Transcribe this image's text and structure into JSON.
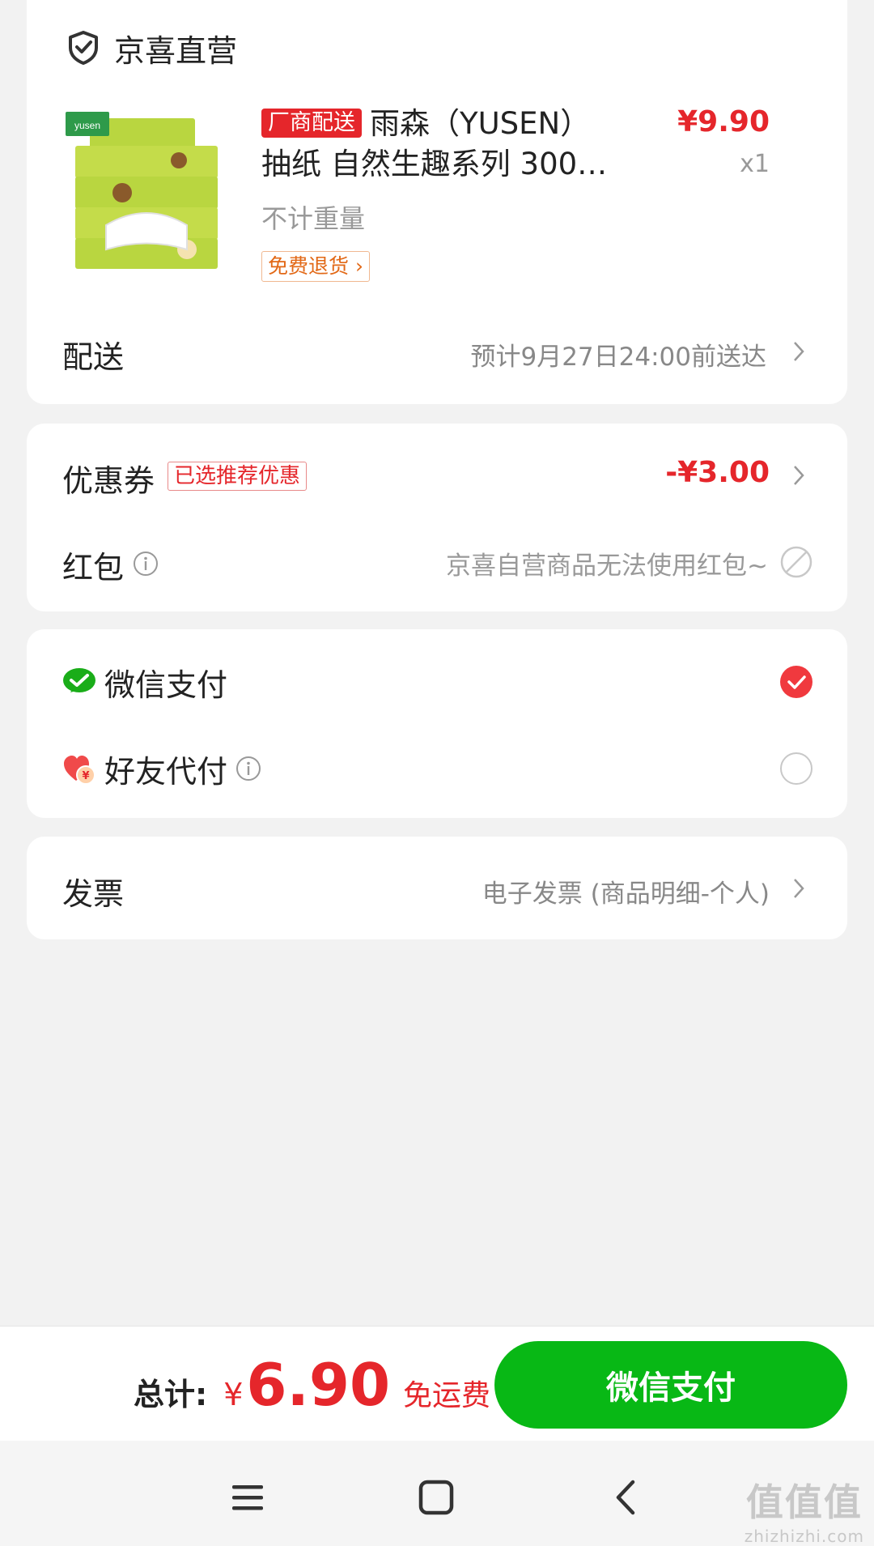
{
  "shop": {
    "name": "京喜直营",
    "icon": "shield-check-icon"
  },
  "product": {
    "vendor_badge": "厂商配送",
    "title": "雨森（YUSEN）抽纸 自然生趣系列 300…",
    "price": "¥9.90",
    "quantity": "x1",
    "spec": "不计重量",
    "return_tag": "免费退货",
    "image_brand": "yusen"
  },
  "delivery": {
    "label": "配送",
    "value": "预计9月27日24:00前送达"
  },
  "coupon": {
    "label": "优惠券",
    "tag": "已选推荐优惠",
    "value": "-¥3.00"
  },
  "red_packet": {
    "label": "红包",
    "value": "京喜自营商品无法使用红包~"
  },
  "payment": {
    "options": [
      {
        "label": "微信支付",
        "icon": "wechat-pay-icon",
        "selected": true
      },
      {
        "label": "好友代付",
        "icon": "friend-pay-heart-icon",
        "selected": false
      }
    ]
  },
  "invoice": {
    "label": "发票",
    "value": "电子发票 (商品明细-个人)"
  },
  "footer": {
    "total_label": "总计:",
    "currency": "¥",
    "total_amount": "6.90",
    "shipping": "免运费",
    "pay_button": "微信支付"
  },
  "watermark": {
    "main": "值值值",
    "sub": "zhizhizhi.com"
  },
  "colors": {
    "accent_red": "#e5262b",
    "wechat_green": "#08b815",
    "background": "#f2f2f2",
    "return_orange": "#e26816"
  }
}
